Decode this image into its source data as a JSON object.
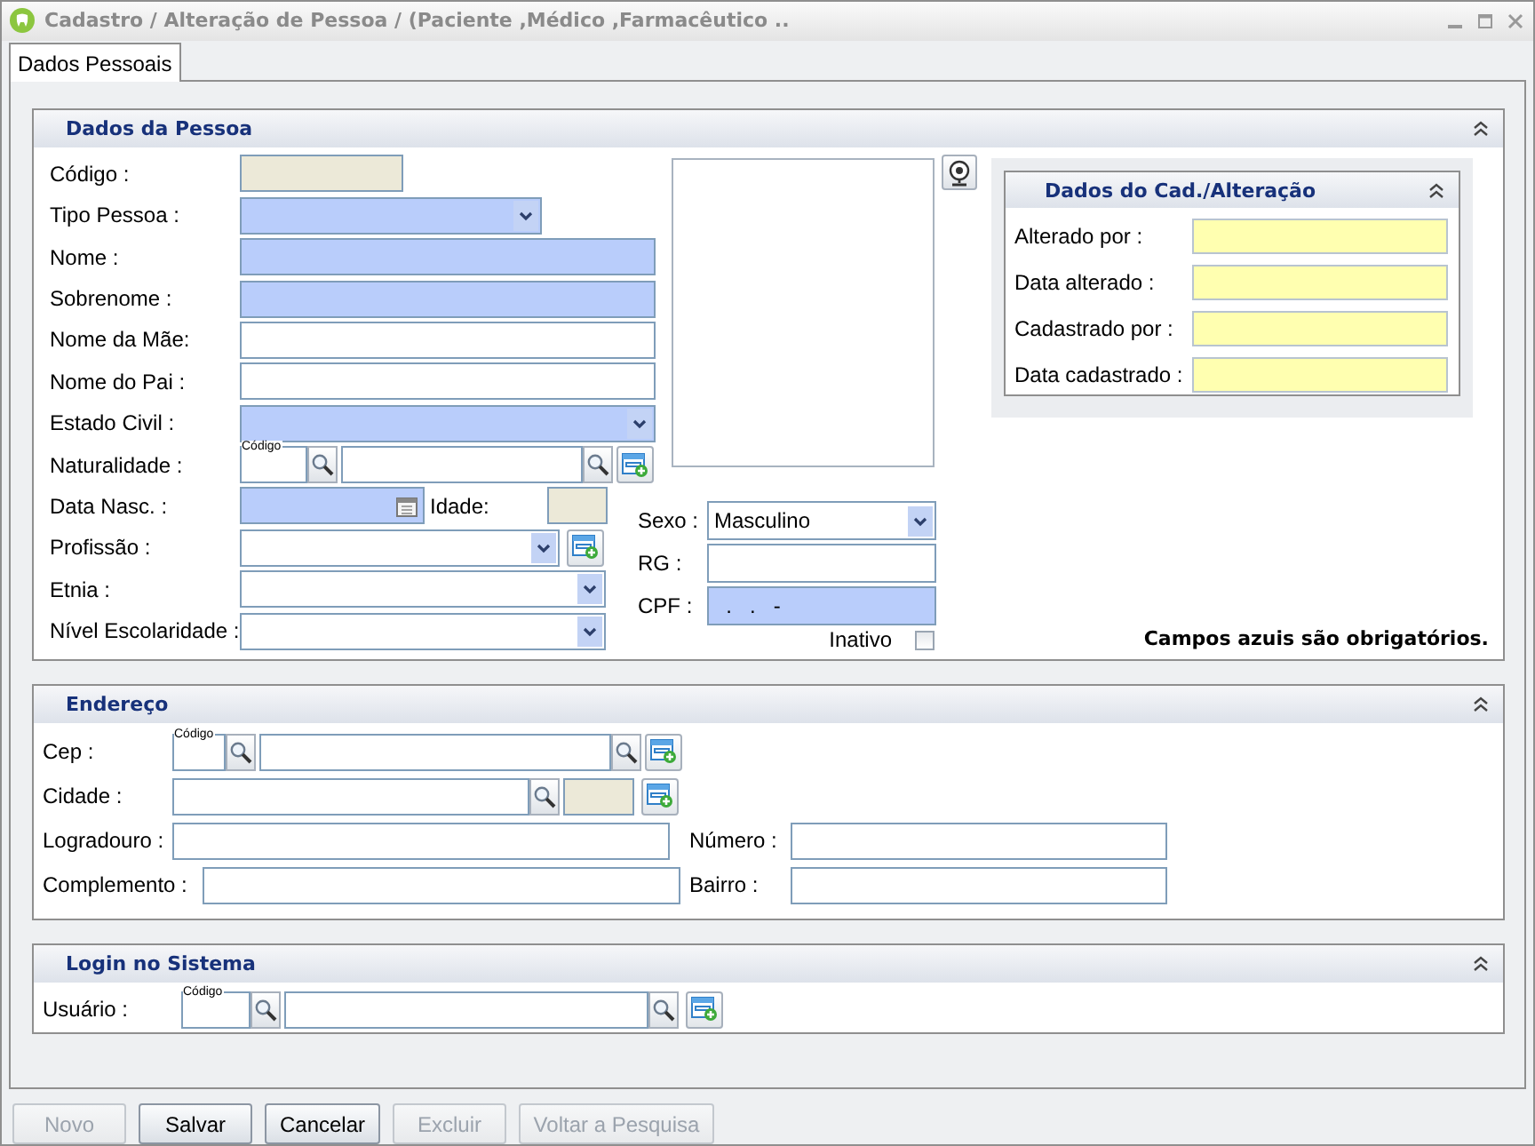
{
  "window": {
    "title": "Cadastro / Alteração de Pessoa / (Paciente ,Médico ,Farmacêutico .."
  },
  "tabs": [
    {
      "label": "Dados Pessoais",
      "selected": true
    }
  ],
  "pessoa": {
    "title": "Dados da Pessoa",
    "rows": [
      {
        "label": "Código :",
        "kind": "readonly"
      },
      {
        "label": "Tipo Pessoa :",
        "kind": "select",
        "required": true
      },
      {
        "label": "Nome :",
        "kind": "text",
        "required": true
      },
      {
        "label": "Sobrenome :",
        "kind": "text",
        "required": true
      },
      {
        "label": "Nome da Mãe:",
        "kind": "text",
        "required": false
      },
      {
        "label": "Nome do Pai :",
        "kind": "text",
        "required": false
      },
      {
        "label": "Estado Civil :",
        "kind": "select",
        "required": true
      },
      {
        "label": "Naturalidade :",
        "kind": "lookup",
        "code_caption": "Código"
      },
      {
        "label": "Data Nasc. :",
        "kind": "date",
        "required": true,
        "extra_label": "Idade:"
      },
      {
        "label": "Profissão :",
        "kind": "select-add",
        "required": false
      },
      {
        "label": "Etnia :",
        "kind": "select",
        "required": false
      },
      {
        "label": "Nível Escolaridade :",
        "kind": "select",
        "required": false
      }
    ],
    "side": [
      {
        "label": "Sexo :",
        "kind": "select",
        "required": false,
        "value": "Masculino"
      },
      {
        "label": "RG :",
        "kind": "text",
        "required": false
      },
      {
        "label": "CPF :",
        "kind": "text",
        "required": true,
        "value": "  .   .   -"
      }
    ],
    "inativo": {
      "label": "Inativo",
      "checked": false
    },
    "audit": {
      "title": "Dados do Cad./Alteração",
      "rows": [
        "Alterado por :",
        "Data alterado :",
        "Cadastrado por :",
        "Data cadastrado :"
      ]
    },
    "note": "Campos azuis são obrigatórios."
  },
  "endereco": {
    "title": "Endereço",
    "rows": [
      {
        "label": "Cep :",
        "kind": "lookup",
        "code_caption": "Código"
      },
      {
        "label": "Cidade :",
        "kind": "search-readonly"
      },
      {
        "label": "Logradouro :",
        "kind": "text",
        "right": {
          "label": "Número :",
          "kind": "text"
        }
      },
      {
        "label": "Complemento :",
        "kind": "text",
        "right": {
          "label": "Bairro :",
          "kind": "text"
        }
      }
    ]
  },
  "login": {
    "title": "Login no Sistema",
    "rows": [
      {
        "label": "Usuário :",
        "kind": "lookup",
        "code_caption": "Código"
      }
    ]
  },
  "buttons": [
    {
      "label": "Novo",
      "disabled": true
    },
    {
      "label": "Salvar",
      "disabled": false
    },
    {
      "label": "Cancelar",
      "disabled": false
    },
    {
      "label": "Excluir",
      "disabled": true
    },
    {
      "label": "Voltar a Pesquisa",
      "disabled": true
    }
  ]
}
